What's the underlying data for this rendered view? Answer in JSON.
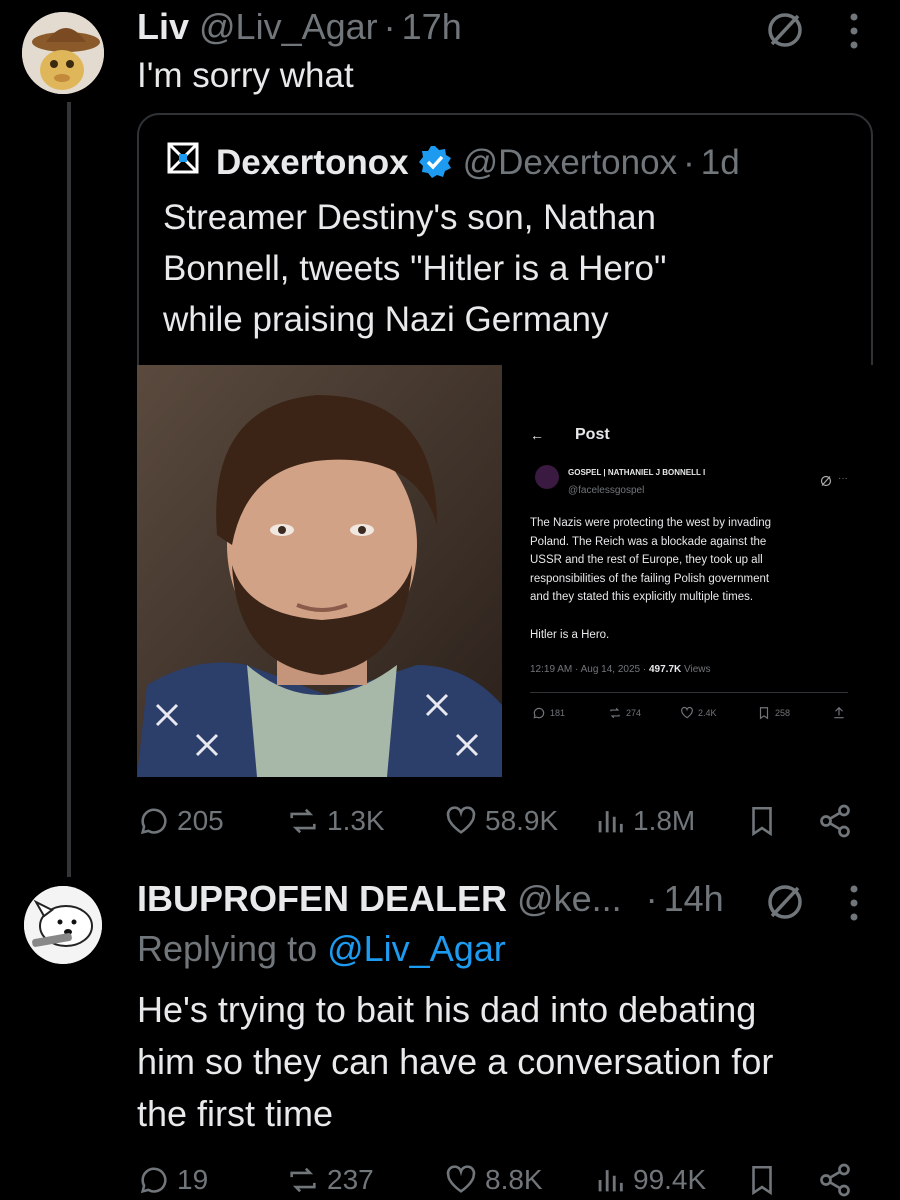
{
  "tweet1": {
    "name": "Liv",
    "handle": "@Liv_Agar",
    "dot": "·",
    "time": "17h",
    "text": "I'm sorry what",
    "stats": {
      "replies": "205",
      "reposts": "1.3K",
      "likes": "58.9K",
      "views": "1.8M"
    }
  },
  "quote": {
    "name": "Dexertonox",
    "handle": "@Dexertonox",
    "dot": "·",
    "time": "1d",
    "text_lines": [
      "Streamer Destiny's son, Nathan",
      "Bonnell, tweets \"Hitler is a Hero\"",
      "while praising Nazi Germany"
    ],
    "embedded": {
      "back_arrow": "←",
      "title": "Post",
      "name": "GOSPEL | NATHANIEL J BONNELL I",
      "handle": "@facelessgospel",
      "more": "···",
      "body_lines": [
        "The Nazis were protecting the west by invading",
        "Poland. The Reich was a blockade against the",
        "USSR and the rest of Europe, they took up all",
        "responsibilities of the failing Polish government",
        "and they stated this explicitly multiple times."
      ],
      "body2": "Hitler is a Hero.",
      "meta_time": "12:19 AM · Aug 14, 2025 · ",
      "meta_views_num": "497.7K",
      "meta_views_label": " Views",
      "stats": {
        "replies": "181",
        "reposts": "274",
        "likes": "2.4K",
        "bookmarks": "258"
      }
    }
  },
  "tweet2": {
    "name": "IBUPROFEN DEALER",
    "handle": "@ke...",
    "dot": "·",
    "time": "14h",
    "replying_prefix": "Replying to ",
    "replying_handle": "@Liv_Agar",
    "text_lines": [
      "He's trying to bait his dad into debating",
      "him so they can have a conversation for",
      "the first time"
    ],
    "stats": {
      "replies": "19",
      "reposts": "237",
      "likes": "8.8K",
      "views": "99.4K"
    }
  },
  "colors": {
    "background": "#000000",
    "text": "#e7e9ea",
    "muted": "#71767b",
    "accent": "#1d9bf0",
    "border": "#2f3336"
  },
  "icons": [
    "mute-icon",
    "more-icon",
    "verified-icon",
    "reply-icon",
    "repost-icon",
    "like-icon",
    "views-icon",
    "bookmark-icon",
    "share-icon"
  ]
}
